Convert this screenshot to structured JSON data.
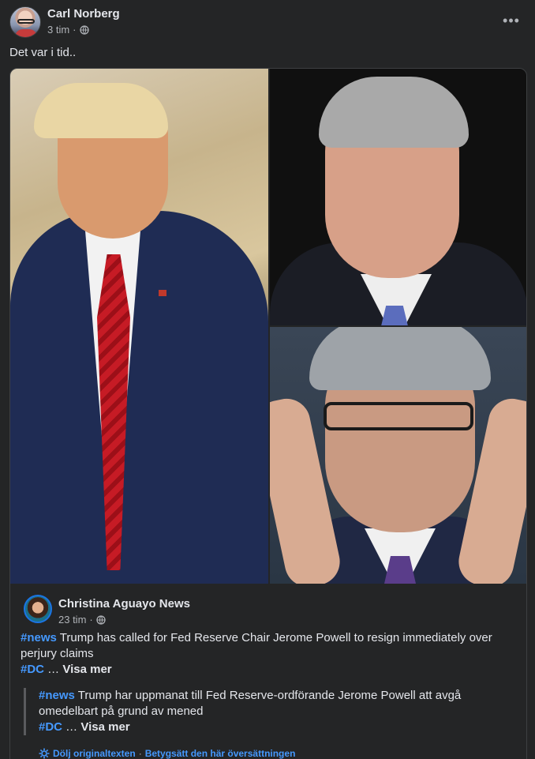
{
  "post": {
    "author": "Carl Norberg",
    "time": "3 tim",
    "separator": "·",
    "text": "Det var i tid..",
    "more_icon": "•••"
  },
  "shared": {
    "page_name": "Christina Aguayo News",
    "time": "23 tim",
    "separator": "·",
    "original": {
      "hashtag1": "#news",
      "text": " Trump has called for Fed Reserve Chair Jerome Powell to resign immediately over perjury claims",
      "hashtag2": "#DC",
      "ellipsis": " … ",
      "see_more": "Visa mer"
    },
    "translation": {
      "hashtag1": "#news",
      "text": " Trump har uppmanat till Fed Reserve-ordförande Jerome Powell att avgå omedelbart på grund av mened",
      "hashtag2": "#DC",
      "ellipsis": " … ",
      "see_more": "Visa mer"
    },
    "footer": {
      "hide_original": "Dölj originaltexten",
      "separator": " · ",
      "rate_translation": "Betygsätt den här översättningen"
    }
  },
  "colors": {
    "background": "#242526",
    "link": "#4599ff",
    "text": "#e4e6eb",
    "muted": "#b0b3b8"
  },
  "icons": [
    "globe-icon",
    "more-icon",
    "gear-icon"
  ]
}
